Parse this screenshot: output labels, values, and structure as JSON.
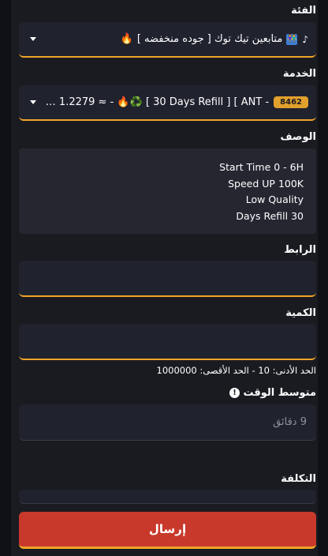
{
  "category": {
    "label": "الفئة",
    "value": "متابعين تيك توك [ جوده منخفضه ]",
    "emoji_prefix": "🔥",
    "icons": [
      "tiktok-icon",
      "people-icon"
    ]
  },
  "service": {
    "label": "الخدمة",
    "badge": "8462",
    "value": "- SAR 1.2279 ≈ - 🔥♻️ [ 30 Days Refill ] [ ANT ...",
    "price": "SAR 1.2279"
  },
  "description": {
    "label": "الوصف",
    "lines": [
      "Start Time 0 - 6H",
      "Speed UP 100K",
      "Low Quality",
      "Days Refill 30"
    ]
  },
  "link": {
    "label": "الرابط",
    "value": ""
  },
  "quantity": {
    "label": "الكمية",
    "value": "",
    "hint": "الحد الأدنى: 10 - الحد الأقصى: 1000000"
  },
  "avg_time": {
    "label": "متوسط الوقت",
    "info_icon": "!",
    "value": "9 دقائق"
  },
  "cost": {
    "label": "التكلفة",
    "value": ""
  },
  "submit": {
    "label": "إرسال"
  },
  "colors": {
    "accent_border": "#f0a529",
    "submit_bg": "#c8392b",
    "badge_bg": "#e2a02c",
    "field_bg": "#20222e"
  }
}
